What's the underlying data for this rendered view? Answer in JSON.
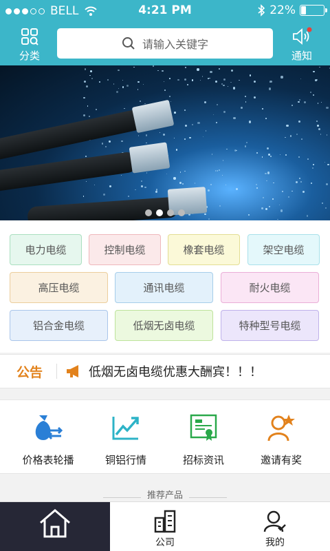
{
  "status_bar": {
    "carrier": "BELL",
    "time": "4:21 PM",
    "battery_percent": "22%",
    "battery_level": 0.22
  },
  "header": {
    "category_label": "分类",
    "search_placeholder": "请输入关键字",
    "notify_label": "通知",
    "color": "#3cb6c9"
  },
  "banner": {
    "pages": 4,
    "active_page": 1
  },
  "categories": [
    {
      "label": "电力电缆",
      "bg": "#e6f7ee",
      "border": "#a9dfbf"
    },
    {
      "label": "控制电缆",
      "bg": "#fbe9ea",
      "border": "#efb7bb"
    },
    {
      "label": "橡套电缆",
      "bg": "#fbf9d8",
      "border": "#e3dd93"
    },
    {
      "label": "架空电缆",
      "bg": "#e4f8fb",
      "border": "#a8e1ea"
    },
    {
      "label": "高压电缆",
      "bg": "#fbf1e1",
      "border": "#ebcd9b"
    },
    {
      "label": "通讯电缆",
      "bg": "#e3f1fb",
      "border": "#a5cdea"
    },
    {
      "label": "耐火电缆",
      "bg": "#fbe6f5",
      "border": "#eaaed7"
    },
    {
      "label": "铝合金电缆",
      "bg": "#e7f0fb",
      "border": "#a9c5ea"
    },
    {
      "label": "低烟无卤电缆",
      "bg": "#ecf9df",
      "border": "#bde39b"
    },
    {
      "label": "特种型号电缆",
      "bg": "#ece6fb",
      "border": "#bfb1ea"
    }
  ],
  "notice": {
    "label": "公告",
    "text": "低烟无卤电缆优惠大酬宾！！！"
  },
  "quick_links": [
    {
      "label": "价格表轮播",
      "icon": "money-bag-icon"
    },
    {
      "label": "铜铝行情",
      "icon": "trend-chart-icon"
    },
    {
      "label": "招标资讯",
      "icon": "certificate-icon"
    },
    {
      "label": "邀请有奖",
      "icon": "invite-star-icon"
    }
  ],
  "recommend_title": "推荐产品",
  "tabs": [
    {
      "label": "",
      "icon": "home-icon",
      "active": true
    },
    {
      "label": "公司",
      "icon": "building-icon",
      "active": false
    },
    {
      "label": "我的",
      "icon": "user-icon",
      "active": false
    }
  ]
}
